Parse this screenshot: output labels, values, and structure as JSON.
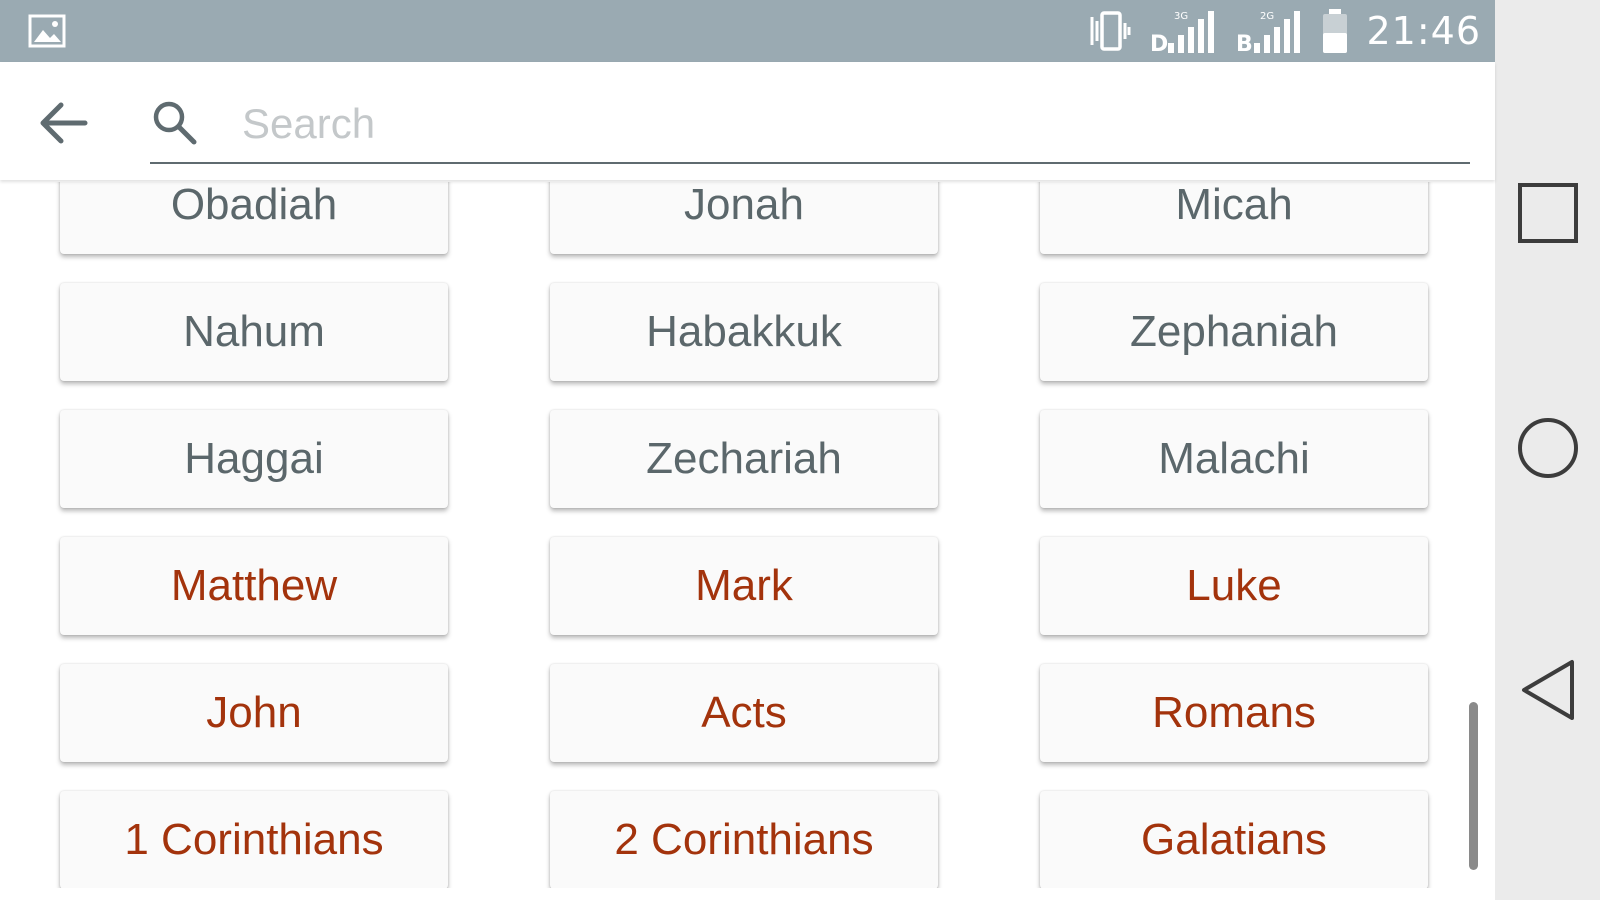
{
  "status_bar": {
    "time": "21:46",
    "left_icon": "gallery-icon",
    "icons": [
      "vibrate-icon",
      "signal-3g-sim1-icon",
      "signal-3g-sim2-icon",
      "battery-icon"
    ],
    "network_labels": [
      "3G",
      "2G"
    ]
  },
  "toolbar": {
    "back_icon": "arrow-back-icon",
    "search_icon": "search-icon",
    "search_placeholder": "Search",
    "search_value": ""
  },
  "books": {
    "rows": [
      [
        {
          "name": "Obadiah",
          "testament": "ot"
        },
        {
          "name": "Jonah",
          "testament": "ot"
        },
        {
          "name": "Micah",
          "testament": "ot"
        }
      ],
      [
        {
          "name": "Nahum",
          "testament": "ot"
        },
        {
          "name": "Habakkuk",
          "testament": "ot"
        },
        {
          "name": "Zephaniah",
          "testament": "ot"
        }
      ],
      [
        {
          "name": "Haggai",
          "testament": "ot"
        },
        {
          "name": "Zechariah",
          "testament": "ot"
        },
        {
          "name": "Malachi",
          "testament": "ot"
        }
      ],
      [
        {
          "name": "Matthew",
          "testament": "nt"
        },
        {
          "name": "Mark",
          "testament": "nt"
        },
        {
          "name": "Luke",
          "testament": "nt"
        }
      ],
      [
        {
          "name": "John",
          "testament": "nt"
        },
        {
          "name": "Acts",
          "testament": "nt"
        },
        {
          "name": "Romans",
          "testament": "nt"
        }
      ],
      [
        {
          "name": "1 Corinthians",
          "testament": "nt"
        },
        {
          "name": "2 Corinthians",
          "testament": "nt"
        },
        {
          "name": "Galatians",
          "testament": "nt"
        }
      ]
    ]
  },
  "navigation_bar": {
    "buttons": [
      "recents-square-icon",
      "home-circle-icon",
      "back-triangle-icon"
    ]
  },
  "colors": {
    "status_bar": "#9aaab2",
    "old_testament_text": "#5b676b",
    "new_testament_text": "#a3330c",
    "nav_bar": "#ebebeb"
  }
}
